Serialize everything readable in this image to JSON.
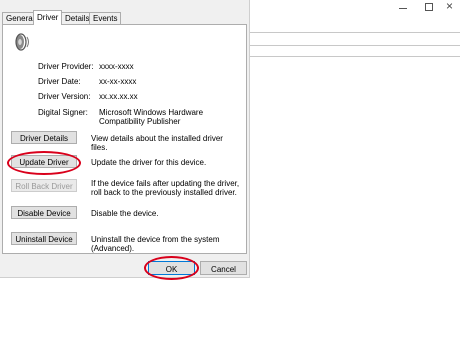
{
  "tabs": [
    {
      "label": "General",
      "active": false
    },
    {
      "label": "Driver",
      "active": true
    },
    {
      "label": "Details",
      "active": false
    },
    {
      "label": "Events",
      "active": false
    }
  ],
  "icons": {
    "device": "speaker-icon",
    "close": "close-icon",
    "minimize": "minimize-icon",
    "maximize": "maximize-icon"
  },
  "info": {
    "provider_label": "Driver Provider:",
    "provider_value": "xxxx-xxxx",
    "date_label": "Driver Date:",
    "date_value": "xx-xx-xxxx",
    "version_label": "Driver Version:",
    "version_value": "xx.xx.xx.xx",
    "signer_label": "Digital Signer:",
    "signer_value": "Microsoft Windows Hardware Compatibility Publisher"
  },
  "actions": {
    "details_label": "Driver Details",
    "details_desc": "View details about the installed driver files.",
    "update_label": "Update Driver",
    "update_desc": "Update the driver for this device.",
    "rollback_label": "Roll Back Driver",
    "rollback_desc": "If the device fails after updating the driver, roll back to the previously installed driver.",
    "disable_label": "Disable Device",
    "disable_desc": "Disable the device.",
    "uninstall_label": "Uninstall Device",
    "uninstall_desc": "Uninstall the device from the system (Advanced)."
  },
  "footer": {
    "ok_label": "OK",
    "cancel_label": "Cancel"
  },
  "colors": {
    "highlight": "#d9001b",
    "dialog_bg": "#f0f0f0",
    "button_bg": "#e1e1e1",
    "default_button_border": "#0078d7"
  },
  "background_window": {
    "close_glyph": "×"
  }
}
